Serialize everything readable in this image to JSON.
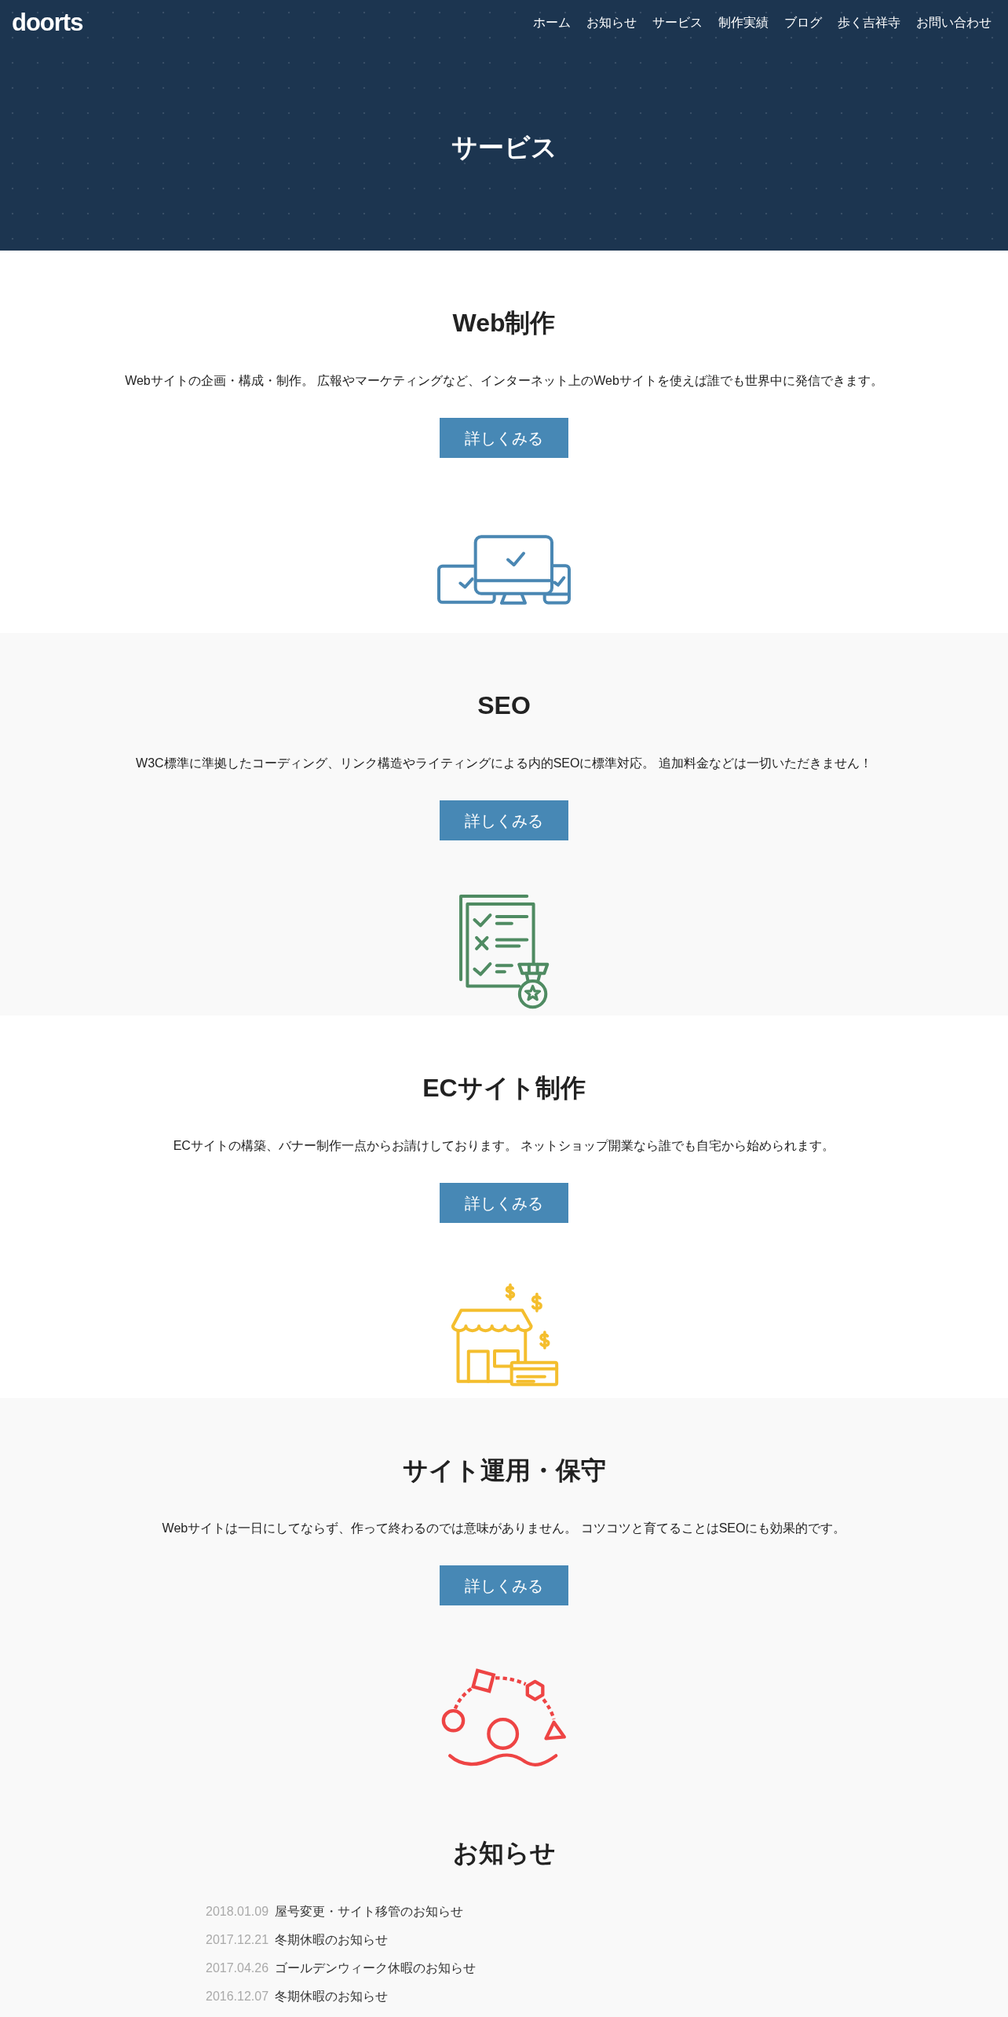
{
  "header": {
    "logo": "doorts",
    "nav": [
      "ホーム",
      "お知らせ",
      "サービス",
      "制作実績",
      "ブログ",
      "歩く吉祥寺",
      "お問い合わせ"
    ]
  },
  "hero": {
    "title": "サービス"
  },
  "services": [
    {
      "kind": "web",
      "title": "Web制作",
      "description": "Webサイトの企画・構成・制作。 広報やマーケティングなど、インターネット上のWebサイトを使えば誰でも世界中に発信できます。",
      "button": "詳しくみる"
    },
    {
      "kind": "seo",
      "title": "SEO",
      "description": "W3C標準に準拠したコーディング、リンク構造やライティングによる内的SEOに標準対応。 追加料金などは一切いただきません！",
      "button": "詳しくみる"
    },
    {
      "kind": "ec",
      "title": "ECサイト制作",
      "description": "ECサイトの構築、バナー制作一点からお請けしております。 ネットショップ開業なら誰でも自宅から始められます。",
      "button": "詳しくみる"
    },
    {
      "kind": "maintenance",
      "title": "サイト運用・保守",
      "description": "Webサイトは一日にしてならず、作って終わるのでは意味がありません。 コツコツと育てることはSEOにも効果的です。",
      "button": "詳しくみる"
    }
  ],
  "news": {
    "title": "お知らせ",
    "items": [
      {
        "date": "2018.01.09",
        "title": "屋号変更・サイト移管のお知らせ"
      },
      {
        "date": "2017.12.21",
        "title": "冬期休暇のお知らせ"
      },
      {
        "date": "2017.04.26",
        "title": "ゴールデンウィーク休暇のお知らせ"
      },
      {
        "date": "2016.12.07",
        "title": "冬期休暇のお知らせ"
      }
    ]
  }
}
